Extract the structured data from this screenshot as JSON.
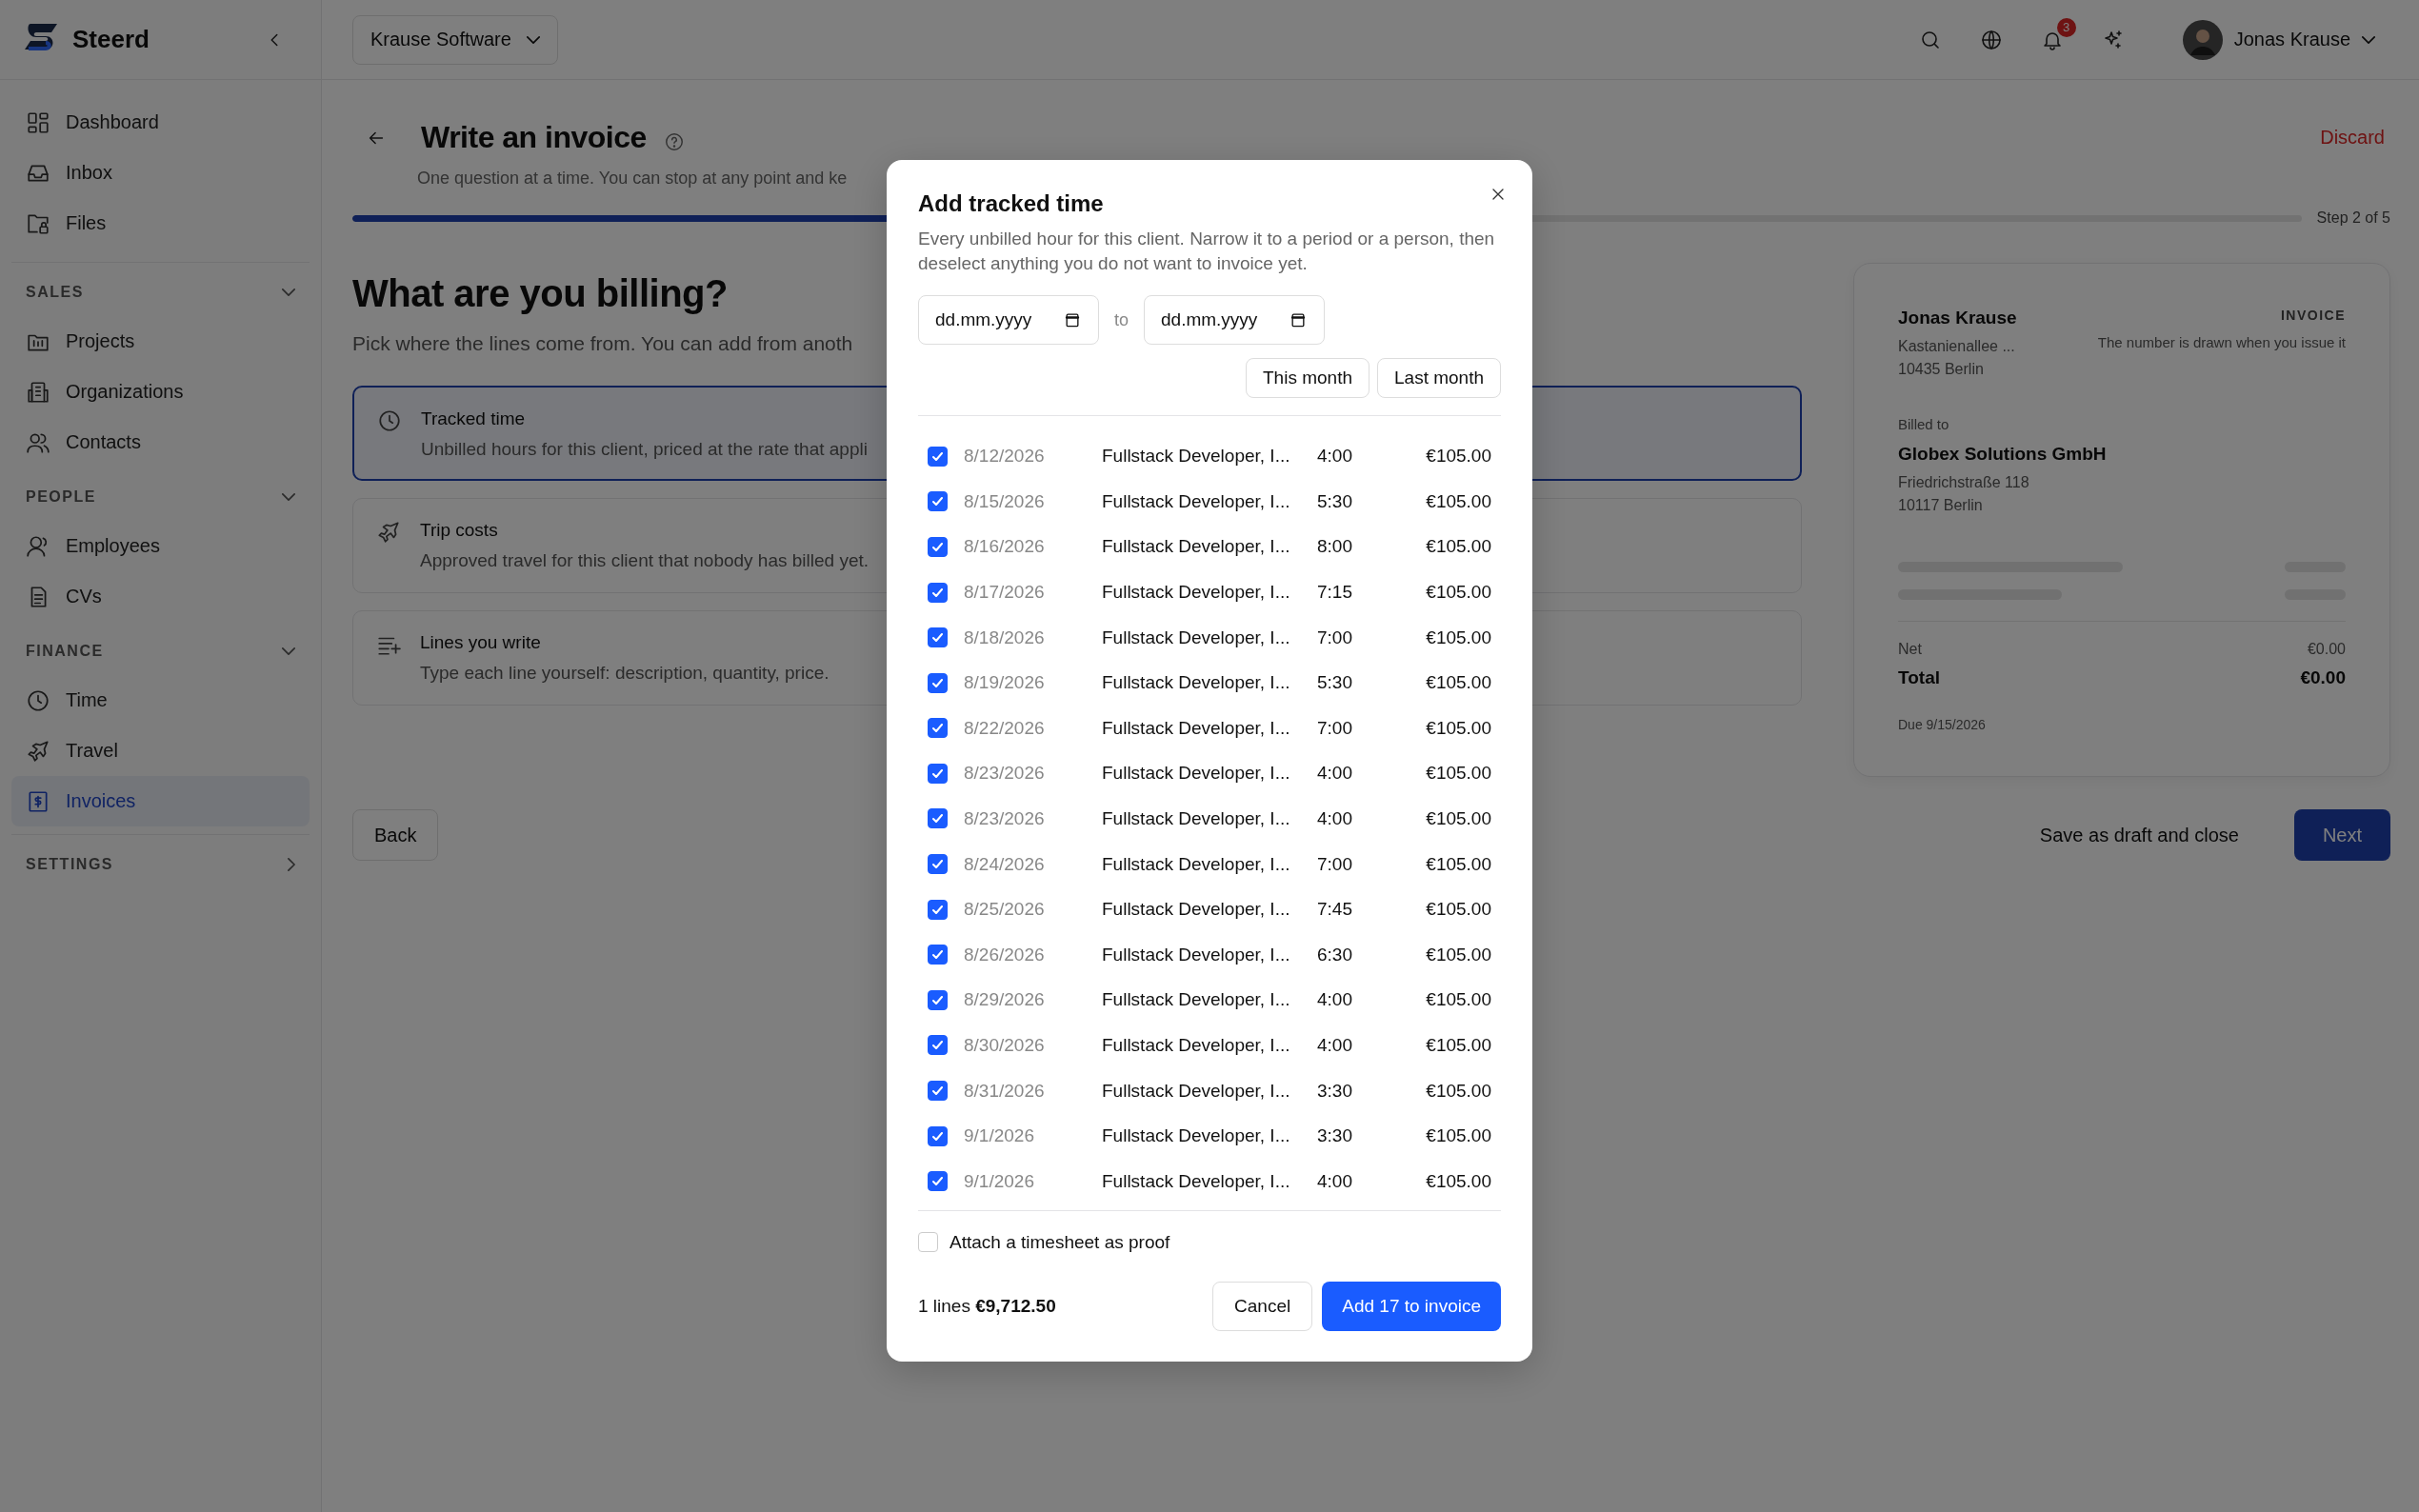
{
  "sidebar": {
    "brand": "Steerd",
    "items": [
      {
        "label": "Dashboard",
        "selected": false
      },
      {
        "label": "Inbox",
        "selected": false
      },
      {
        "label": "Files",
        "selected": false
      }
    ],
    "sections": [
      {
        "title": "SALES",
        "expanded": true,
        "items": [
          {
            "label": "Projects",
            "selected": false
          },
          {
            "label": "Organizations",
            "selected": false
          },
          {
            "label": "Contacts",
            "selected": false
          }
        ]
      },
      {
        "title": "PEOPLE",
        "expanded": true,
        "items": [
          {
            "label": "Employees",
            "selected": false
          },
          {
            "label": "CVs",
            "selected": false
          }
        ]
      },
      {
        "title": "FINANCE",
        "expanded": true,
        "items": [
          {
            "label": "Time",
            "selected": false
          },
          {
            "label": "Travel",
            "selected": false
          },
          {
            "label": "Invoices",
            "selected": true
          }
        ]
      },
      {
        "title": "SETTINGS",
        "expanded": false
      }
    ]
  },
  "topbar": {
    "organization": "Krause Software",
    "notification_count": "3",
    "user_name": "Jonas Krause"
  },
  "wizard": {
    "title": "Write an invoice",
    "subtitle": "One question at a time. You can stop at any point and ke",
    "discard": "Discard",
    "progress": {
      "level": 0.4,
      "label": "Step 2 of 5"
    },
    "question": "What are you billing?",
    "hint": "Pick where the lines come from. You can add from anoth",
    "options": [
      {
        "title": "Tracked time",
        "description": "Unbilled hours for this client, priced at the rate that appli",
        "selected": true
      },
      {
        "title": "Trip costs",
        "description": "Approved travel for this client that nobody has billed yet.",
        "selected": false
      },
      {
        "title": "Lines you write",
        "description": "Type each line yourself: description, quantity, price.",
        "selected": false
      }
    ],
    "back": "Back",
    "save_draft": "Save as draft and close",
    "next": "Next"
  },
  "preview": {
    "sender_name": "Jonas Krause",
    "sender_street": "Kastanienallee ...",
    "sender_city": "10435 Berlin",
    "doc_label": "INVOICE",
    "number_note": "The number is drawn when you issue it",
    "billed_to_label": "Billed to",
    "client_name": "Globex Solutions GmbH",
    "client_street": "Friedrichstraße 118",
    "client_city": "10117 Berlin",
    "net_label": "Net",
    "net_value": "€0.00",
    "total_label": "Total",
    "total_value": "€0.00",
    "due": "Due 9/15/2026"
  },
  "modal": {
    "title": "Add tracked time",
    "description": "Every unbilled hour for this client. Narrow it to a period or a person, then deselect anything you do not want to invoice yet.",
    "date_from": {
      "placeholder": "dd.mm.yyyy"
    },
    "range_separator": "to",
    "date_to": {
      "placeholder": "dd.mm.yyyy"
    },
    "presets": [
      "This month",
      "Last month"
    ],
    "entries": [
      {
        "date": "8/12/2026",
        "description": "Fullstack Developer, I...",
        "duration": "4:00",
        "amount": "€105.00",
        "checked": true
      },
      {
        "date": "8/15/2026",
        "description": "Fullstack Developer, I...",
        "duration": "5:30",
        "amount": "€105.00",
        "checked": true
      },
      {
        "date": "8/16/2026",
        "description": "Fullstack Developer, I...",
        "duration": "8:00",
        "amount": "€105.00",
        "checked": true
      },
      {
        "date": "8/17/2026",
        "description": "Fullstack Developer, I...",
        "duration": "7:15",
        "amount": "€105.00",
        "checked": true
      },
      {
        "date": "8/18/2026",
        "description": "Fullstack Developer, I...",
        "duration": "7:00",
        "amount": "€105.00",
        "checked": true
      },
      {
        "date": "8/19/2026",
        "description": "Fullstack Developer, I...",
        "duration": "5:30",
        "amount": "€105.00",
        "checked": true
      },
      {
        "date": "8/22/2026",
        "description": "Fullstack Developer, I...",
        "duration": "7:00",
        "amount": "€105.00",
        "checked": true
      },
      {
        "date": "8/23/2026",
        "description": "Fullstack Developer, I...",
        "duration": "4:00",
        "amount": "€105.00",
        "checked": true
      },
      {
        "date": "8/23/2026",
        "description": "Fullstack Developer, I...",
        "duration": "4:00",
        "amount": "€105.00",
        "checked": true
      },
      {
        "date": "8/24/2026",
        "description": "Fullstack Developer, I...",
        "duration": "7:00",
        "amount": "€105.00",
        "checked": true
      },
      {
        "date": "8/25/2026",
        "description": "Fullstack Developer, I...",
        "duration": "7:45",
        "amount": "€105.00",
        "checked": true
      },
      {
        "date": "8/26/2026",
        "description": "Fullstack Developer, I...",
        "duration": "6:30",
        "amount": "€105.00",
        "checked": true
      },
      {
        "date": "8/29/2026",
        "description": "Fullstack Developer, I...",
        "duration": "4:00",
        "amount": "€105.00",
        "checked": true
      },
      {
        "date": "8/30/2026",
        "description": "Fullstack Developer, I...",
        "duration": "4:00",
        "amount": "€105.00",
        "checked": true
      },
      {
        "date": "8/31/2026",
        "description": "Fullstack Developer, I...",
        "duration": "3:30",
        "amount": "€105.00",
        "checked": true
      },
      {
        "date": "9/1/2026",
        "description": "Fullstack Developer, I...",
        "duration": "3:30",
        "amount": "€105.00",
        "checked": true
      },
      {
        "date": "9/1/2026",
        "description": "Fullstack Developer, I...",
        "duration": "4:00",
        "amount": "€105.00",
        "checked": true
      }
    ],
    "attach": {
      "label": "Attach a timesheet as proof",
      "checked": false
    },
    "summary": "1 lines **€9,712.50**",
    "cancel": "Cancel",
    "confirm": "Add 17 to invoice"
  }
}
